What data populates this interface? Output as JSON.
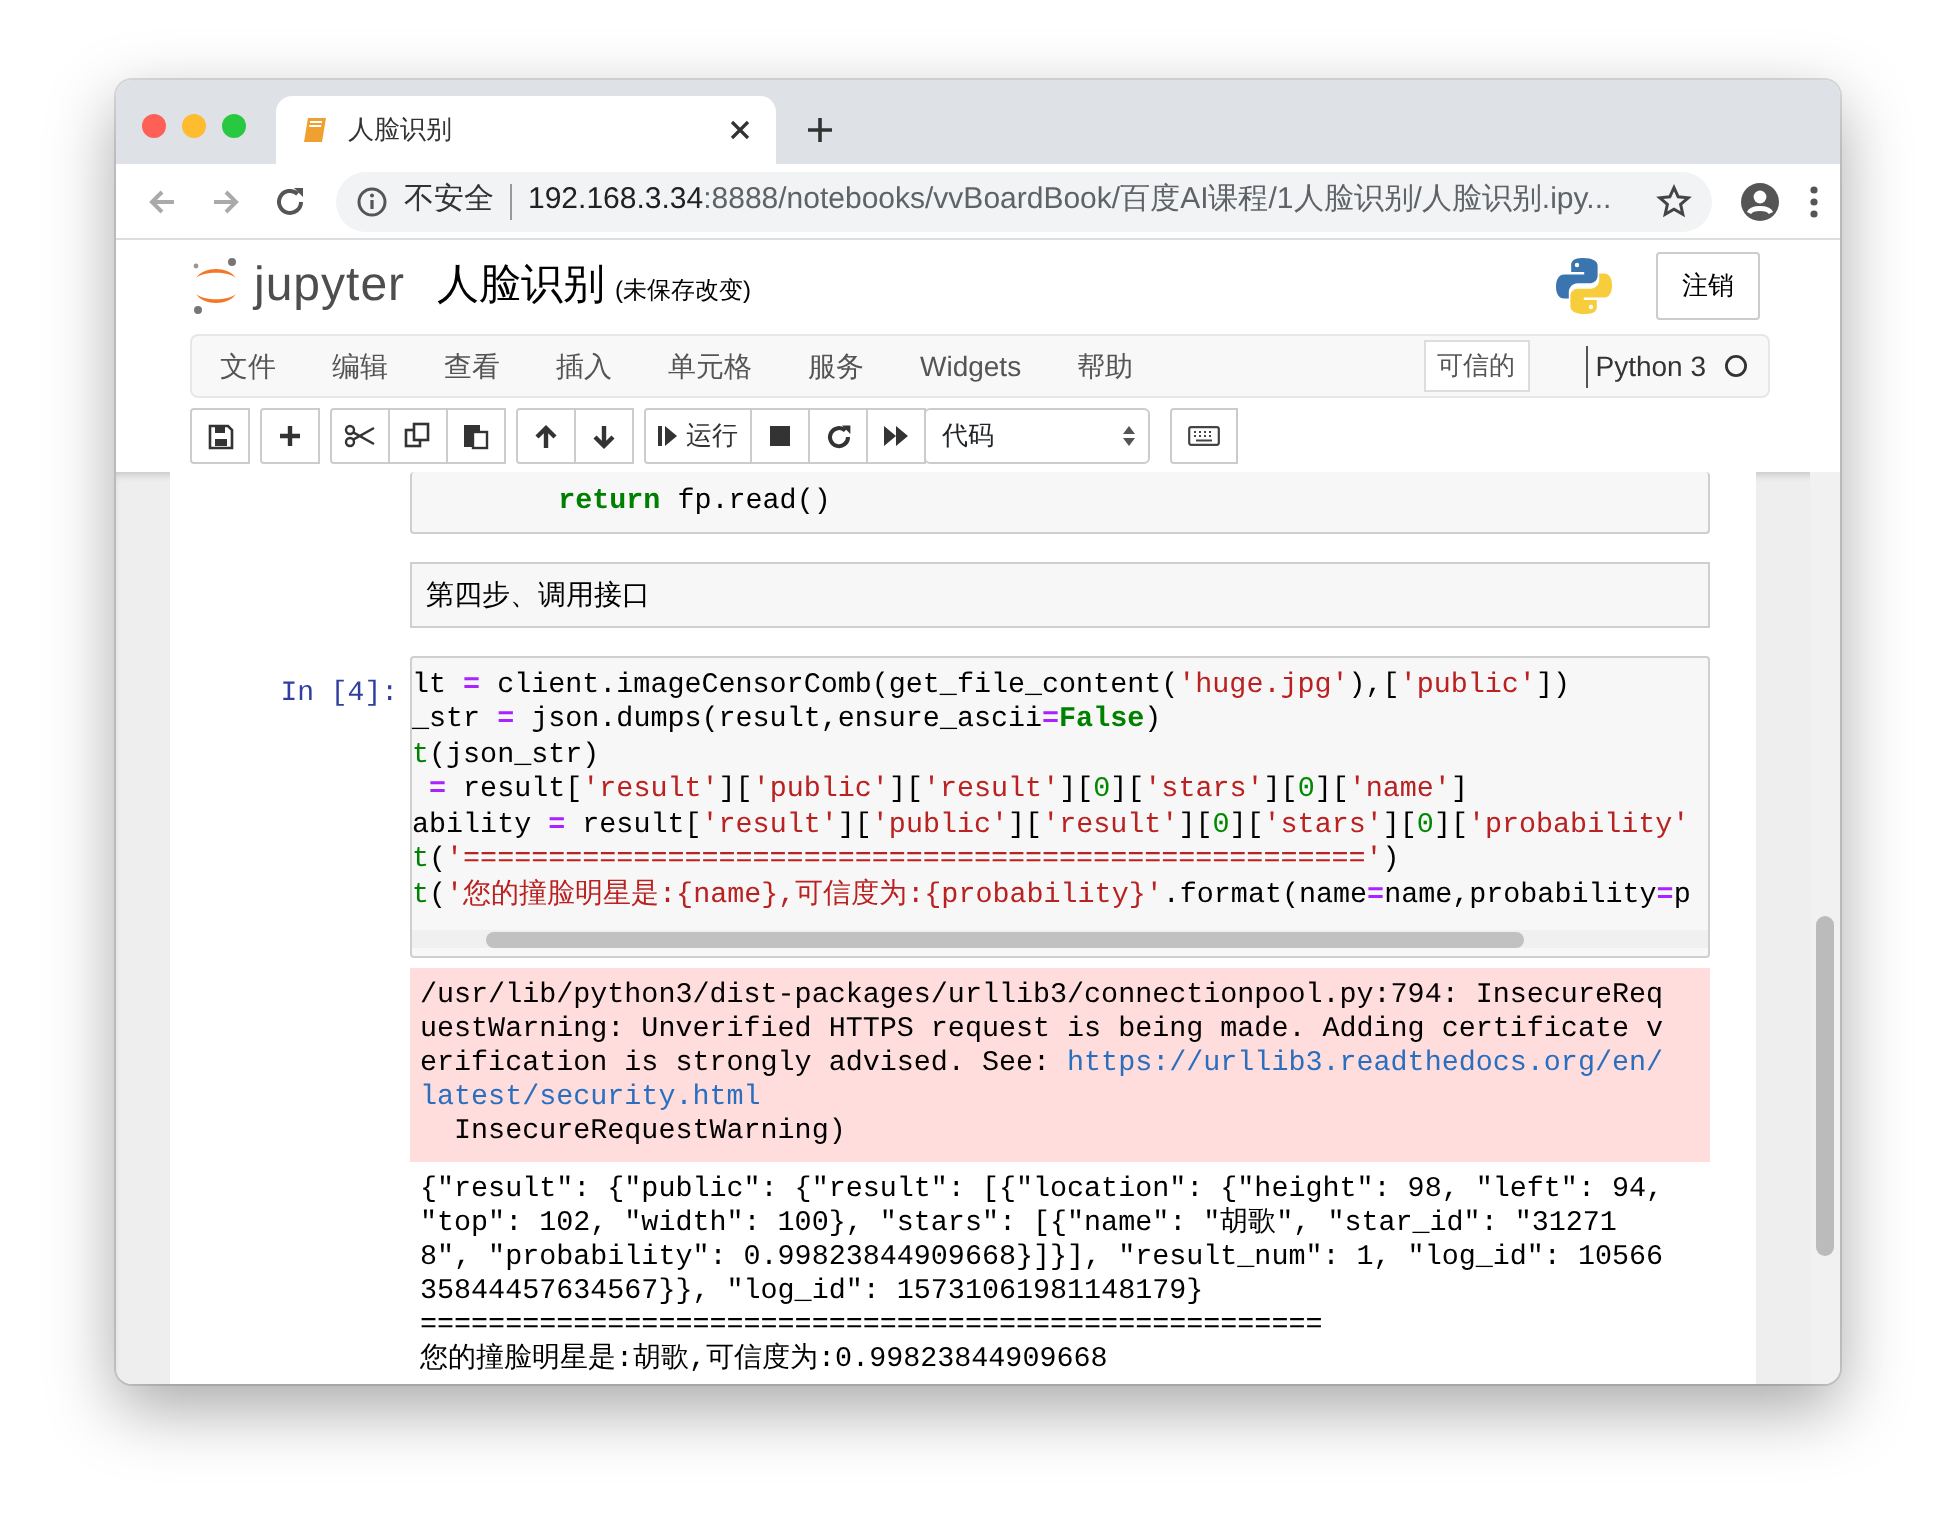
{
  "browser": {
    "tab_title": "人脸识别",
    "security": "不安全",
    "host": "192.168.3.34",
    "path": ":8888/notebooks/vvBoardBook/百度AI课程/1人脸识别/人脸识别.ipy..."
  },
  "header": {
    "logo_text": "jupyter",
    "title": "人脸识别",
    "save_status": "(未保存改变)",
    "logout": "注销"
  },
  "menu": [
    "文件",
    "编辑",
    "查看",
    "插入",
    "单元格",
    "服务",
    "Widgets",
    "帮助"
  ],
  "trusted": "可信的",
  "kernel": {
    "name": "Python 3",
    "busy": false
  },
  "toolbar": {
    "run": "运行",
    "cell_type": "代码"
  },
  "cells": [
    {
      "kind": "code_tail",
      "lines": [
        {
          "tokens": [
            {
              "text": "        return",
              "kind": "kw"
            },
            {
              "text": " fp.read()",
              "kind": "plain"
            }
          ]
        }
      ]
    },
    {
      "kind": "markdown",
      "text": "第四步、调用接口"
    },
    {
      "kind": "code",
      "prompt": "In [4]:",
      "lines": [
        {
          "tokens": [
            {
              "text": "lt ",
              "kind": "plain"
            },
            {
              "text": "=",
              "kind": "op"
            },
            {
              "text": " client.imageCensorComb(get_file_content(",
              "kind": "plain"
            },
            {
              "text": "'huge.jpg'",
              "kind": "str"
            },
            {
              "text": "),[",
              "kind": "plain"
            },
            {
              "text": "'public'",
              "kind": "str"
            },
            {
              "text": "])",
              "kind": "plain"
            }
          ]
        },
        {
          "tokens": [
            {
              "text": "_str ",
              "kind": "plain"
            },
            {
              "text": "=",
              "kind": "op"
            },
            {
              "text": " json.dumps(result,ensure_ascii",
              "kind": "plain"
            },
            {
              "text": "=",
              "kind": "op"
            },
            {
              "text": "False",
              "kind": "kw"
            },
            {
              "text": ")",
              "kind": "plain"
            }
          ]
        },
        {
          "tokens": [
            {
              "text": "t",
              "kind": "builtin"
            },
            {
              "text": "(json_str)",
              "kind": "plain"
            }
          ]
        },
        {
          "tokens": [
            {
              "text": " =",
              "kind": "op"
            },
            {
              "text": " result[",
              "kind": "plain"
            },
            {
              "text": "'result'",
              "kind": "str"
            },
            {
              "text": "][",
              "kind": "plain"
            },
            {
              "text": "'public'",
              "kind": "str"
            },
            {
              "text": "][",
              "kind": "plain"
            },
            {
              "text": "'result'",
              "kind": "str"
            },
            {
              "text": "][",
              "kind": "plain"
            },
            {
              "text": "0",
              "kind": "num"
            },
            {
              "text": "][",
              "kind": "plain"
            },
            {
              "text": "'stars'",
              "kind": "str"
            },
            {
              "text": "][",
              "kind": "plain"
            },
            {
              "text": "0",
              "kind": "num"
            },
            {
              "text": "][",
              "kind": "plain"
            },
            {
              "text": "'name'",
              "kind": "str"
            },
            {
              "text": "]",
              "kind": "plain"
            }
          ]
        },
        {
          "tokens": [
            {
              "text": "ability ",
              "kind": "plain"
            },
            {
              "text": "=",
              "kind": "op"
            },
            {
              "text": " result[",
              "kind": "plain"
            },
            {
              "text": "'result'",
              "kind": "str"
            },
            {
              "text": "][",
              "kind": "plain"
            },
            {
              "text": "'public'",
              "kind": "str"
            },
            {
              "text": "][",
              "kind": "plain"
            },
            {
              "text": "'result'",
              "kind": "str"
            },
            {
              "text": "][",
              "kind": "plain"
            },
            {
              "text": "0",
              "kind": "num"
            },
            {
              "text": "][",
              "kind": "plain"
            },
            {
              "text": "'stars'",
              "kind": "str"
            },
            {
              "text": "][",
              "kind": "plain"
            },
            {
              "text": "0",
              "kind": "num"
            },
            {
              "text": "][",
              "kind": "plain"
            },
            {
              "text": "'probability'",
              "kind": "str"
            }
          ]
        },
        {
          "tokens": [
            {
              "text": "t",
              "kind": "builtin"
            },
            {
              "text": "(",
              "kind": "plain"
            },
            {
              "text": "'====================================================='",
              "kind": "str"
            },
            {
              "text": ")",
              "kind": "plain"
            }
          ]
        },
        {
          "tokens": [
            {
              "text": "t",
              "kind": "builtin"
            },
            {
              "text": "(",
              "kind": "plain"
            },
            {
              "text": "'您的撞脸明星是:{name},可信度为:{probability}'",
              "kind": "str"
            },
            {
              "text": ".format(name",
              "kind": "plain"
            },
            {
              "text": "=",
              "kind": "op"
            },
            {
              "text": "name,probability",
              "kind": "plain"
            },
            {
              "text": "=",
              "kind": "op"
            },
            {
              "text": "p",
              "kind": "plain"
            }
          ]
        }
      ],
      "outputs": [
        {
          "kind": "stderr",
          "lines": [
            {
              "tokens": [
                {
                  "text": "/usr/lib/python3/dist-packages/urllib3/connectionpool.py:794: InsecureReq",
                  "kind": "text"
                }
              ]
            },
            {
              "tokens": [
                {
                  "text": "uestWarning: Unverified HTTPS request is being made. Adding certificate v",
                  "kind": "text"
                }
              ]
            },
            {
              "tokens": [
                {
                  "text": "erification is strongly advised. See: ",
                  "kind": "text"
                },
                {
                  "text": "https://urllib3.readthedocs.org/en/",
                  "kind": "link"
                }
              ]
            },
            {
              "tokens": [
                {
                  "text": "latest/security.html",
                  "kind": "link"
                }
              ]
            },
            {
              "tokens": [
                {
                  "text": "  InsecureRequestWarning)",
                  "kind": "text"
                }
              ]
            }
          ]
        },
        {
          "kind": "stdout",
          "lines": [
            {
              "tokens": [
                {
                  "text": "{\"result\": {\"public\": {\"result\": [{\"location\": {\"height\": 98, \"left\": 94,",
                  "kind": "text"
                }
              ]
            },
            {
              "tokens": [
                {
                  "text": "\"top\": 102, \"width\": 100}, \"stars\": [{\"name\": \"胡歌\", \"star_id\": \"31271",
                  "kind": "text"
                }
              ]
            },
            {
              "tokens": [
                {
                  "text": "8\", \"probability\": 0.99823844909668}]}], \"result_num\": 1, \"log_id\": 10566",
                  "kind": "text"
                }
              ]
            },
            {
              "tokens": [
                {
                  "text": "35844457634567}}, \"log_id\": 15731061981148179}",
                  "kind": "text"
                }
              ]
            },
            {
              "tokens": [
                {
                  "text": "=====================================================",
                  "kind": "text"
                }
              ]
            },
            {
              "tokens": [
                {
                  "text": "您的撞脸明星是:胡歌,可信度为:0.99823844909668",
                  "kind": "text"
                }
              ]
            }
          ]
        }
      ]
    }
  ]
}
